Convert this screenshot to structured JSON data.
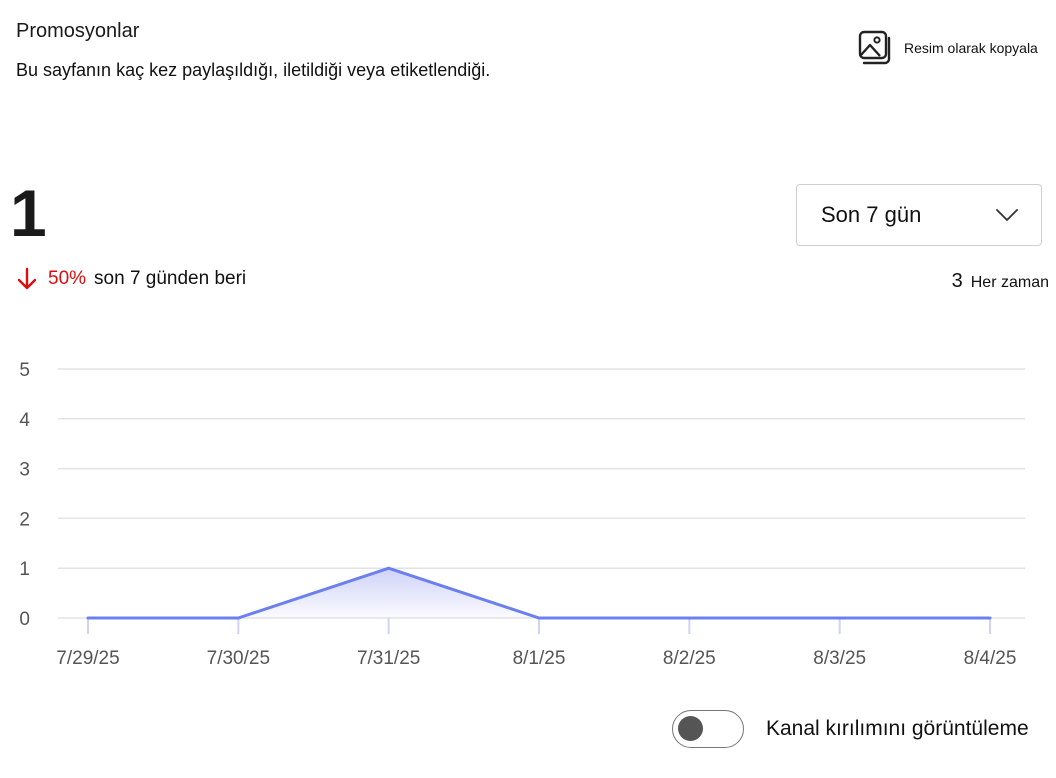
{
  "header": {
    "title": "Promosyonlar",
    "subtitle": "Bu sayfanın kaç kez paylaşıldığı, iletildiği veya etiketlendiği.",
    "copy_image_label": "Resim olarak kopyala"
  },
  "summary": {
    "value": "1",
    "change_percent": "50%",
    "change_direction": "down",
    "change_text": "son 7 günden beri",
    "all_time_value": "3",
    "all_time_label": "Her zaman"
  },
  "period_select": {
    "selected": "Son 7 gün"
  },
  "toggle": {
    "label": "Kanal kırılımını görüntüleme",
    "on": false
  },
  "colors": {
    "line": "#6b7ff0",
    "area_top": "#c9cdf6",
    "down": "#d90f0f",
    "grid": "#e3e3e3"
  },
  "chart_data": {
    "type": "area",
    "x": [
      "7/29/25",
      "7/30/25",
      "7/31/25",
      "8/1/25",
      "8/2/25",
      "8/3/25",
      "8/4/25"
    ],
    "series": [
      {
        "values": [
          0,
          0,
          1,
          0,
          0,
          0,
          0
        ]
      }
    ],
    "yticks": [
      "0",
      "1",
      "2",
      "3",
      "4",
      "5"
    ],
    "ylim": [
      0,
      5
    ],
    "grid": true,
    "legend": "none"
  }
}
